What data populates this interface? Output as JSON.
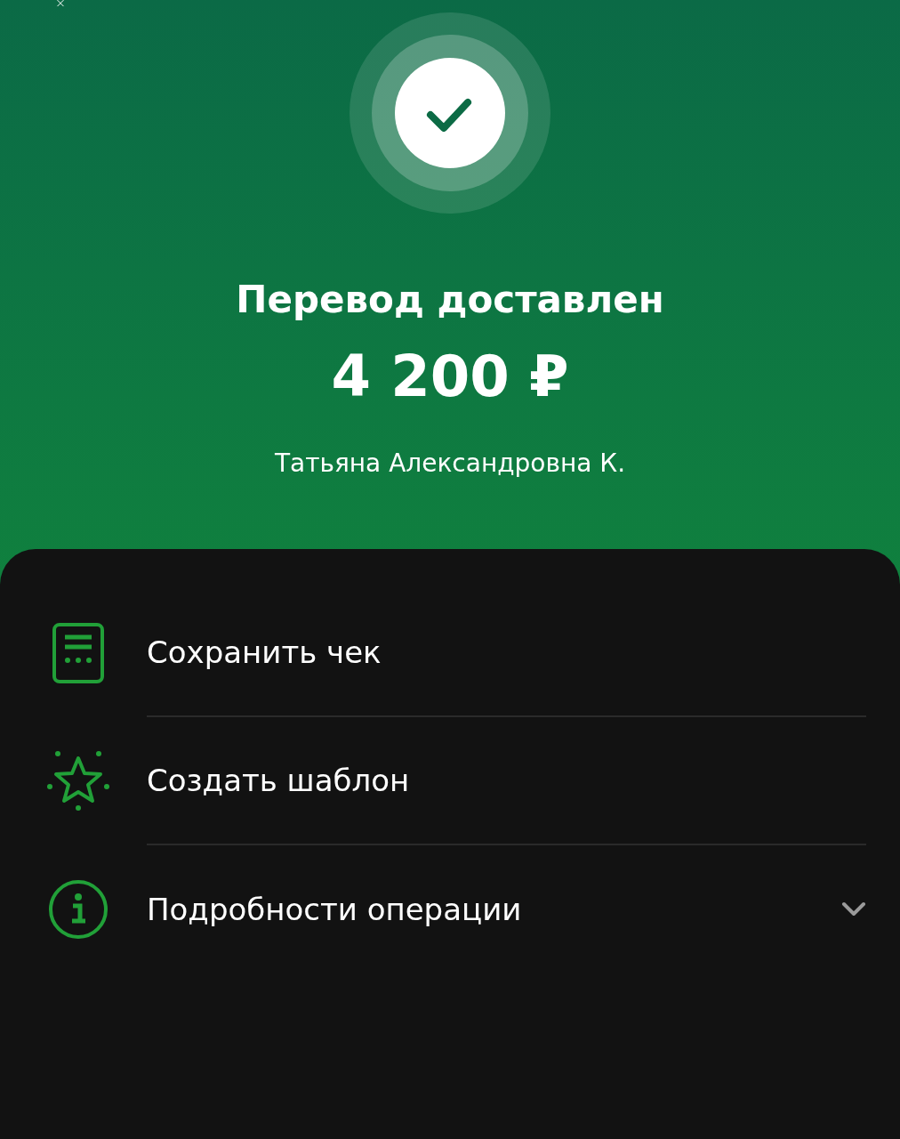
{
  "header": {
    "title": "Перевод доставлен",
    "amount": "4 200 ₽",
    "recipient": "Татьяна Александровна К."
  },
  "actions": [
    {
      "kind": "receipt",
      "label": "Сохранить чек"
    },
    {
      "kind": "template",
      "label": "Создать шаблон"
    },
    {
      "kind": "details",
      "label": "Подробности операции"
    }
  ]
}
